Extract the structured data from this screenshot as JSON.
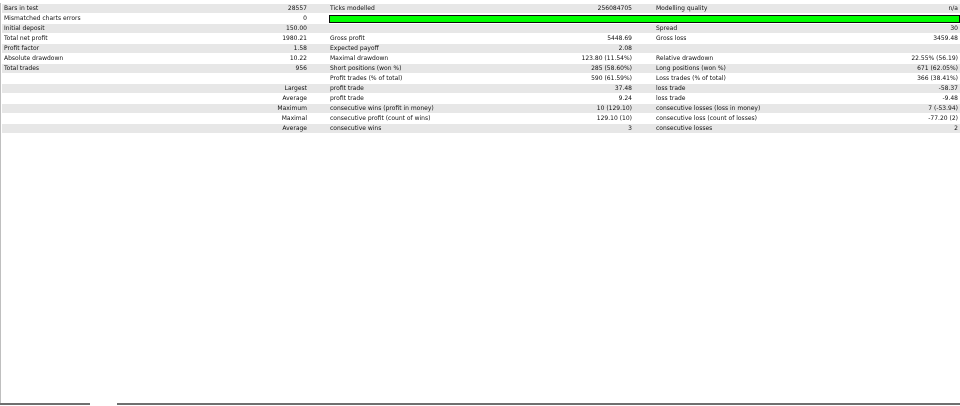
{
  "report": {
    "row1": {
      "bars_label": "Bars in test",
      "bars_value": "28557",
      "ticks_label": "Ticks modelled",
      "ticks_value": "256084705",
      "quality_label": "Modelling quality",
      "quality_value": "n/a"
    },
    "row2": {
      "mismatched_label": "Mismatched charts errors",
      "mismatched_value": "0",
      "quality_fraction": 1.0,
      "quality_color": "#00ff00"
    },
    "row3": {
      "deposit_label": "Initial deposit",
      "deposit_value": "150.00",
      "spread_label": "Spread",
      "spread_value": "30"
    },
    "row4": {
      "net_label": "Total net profit",
      "net_value": "1980.21",
      "gross_profit_label": "Gross profit",
      "gross_profit_value": "5448.69",
      "gross_loss_label": "Gross loss",
      "gross_loss_value": "3459.48"
    },
    "row5": {
      "pf_label": "Profit factor",
      "pf_value": "1.58",
      "ep_label": "Expected payoff",
      "ep_value": "2.08"
    },
    "row6": {
      "abs_dd_label": "Absolute drawdown",
      "abs_dd_value": "10.22",
      "max_dd_label": "Maximal drawdown",
      "max_dd_value": "123.80 (11.54%)",
      "rel_dd_label": "Relative drawdown",
      "rel_dd_value": "22.55% (56.19)"
    },
    "row7": {
      "trades_label": "Total trades",
      "trades_value": "956",
      "short_label": "Short positions (won %)",
      "short_value": "285 (58.60%)",
      "long_label": "Long positions (won %)",
      "long_value": "671 (62.05%)"
    },
    "row8": {
      "profit_trades_label": "Profit trades (% of total)",
      "profit_trades_value": "590 (61.59%)",
      "loss_trades_label": "Loss trades (% of total)",
      "loss_trades_value": "366 (38.41%)"
    },
    "row9": {
      "largest_label": "Largest",
      "profit_trade_label": "profit trade",
      "profit_trade_value": "37.48",
      "loss_trade_label": "loss trade",
      "loss_trade_value": "-58.37"
    },
    "row10": {
      "average_label": "Average",
      "profit_trade_label": "profit trade",
      "profit_trade_value": "9.24",
      "loss_trade_label": "loss trade",
      "loss_trade_value": "-9.48"
    },
    "row11": {
      "maximum_label": "Maximum",
      "cons_wins_money_label": "consecutive wins (profit in money)",
      "cons_wins_money_value": "10 (129.10)",
      "cons_losses_money_label": "consecutive losses (loss in money)",
      "cons_losses_money_value": "7 (-53.94)"
    },
    "row12": {
      "maximal_label": "Maximal",
      "cons_profit_count_label": "consecutive profit (count of wins)",
      "cons_profit_count_value": "129.10 (10)",
      "cons_loss_count_label": "consecutive loss (count of losses)",
      "cons_loss_count_value": "-77.20 (2)"
    },
    "row13": {
      "average_label": "Average",
      "cons_wins_label": "consecutive wins",
      "cons_wins_value": "3",
      "cons_losses_label": "consecutive losses",
      "cons_losses_value": "2"
    }
  }
}
